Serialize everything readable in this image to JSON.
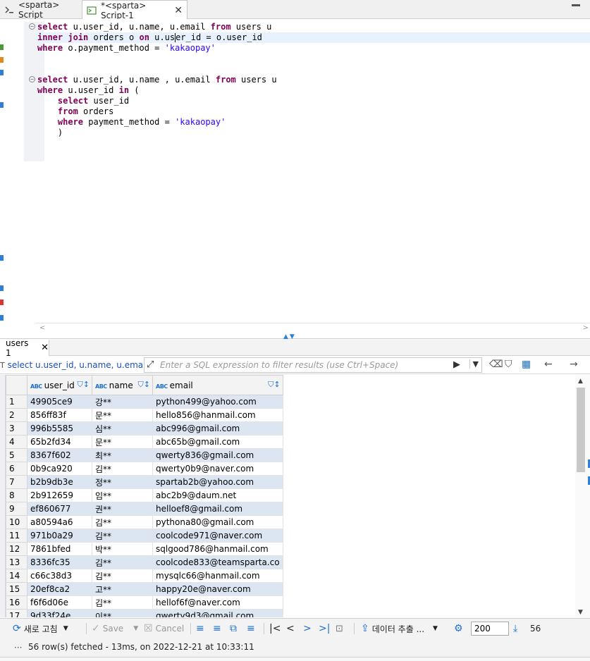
{
  "editor_tabs": [
    {
      "label": "<sparta> Script",
      "active": false
    },
    {
      "label": "*<sparta> Script-1",
      "active": true
    }
  ],
  "editor": {
    "lines": [
      [
        {
          "t": "select",
          "k": "kw"
        },
        {
          "t": " u.user_id, u.name, u.email "
        },
        {
          "t": "from",
          "k": "kw"
        },
        {
          "t": " users u"
        }
      ],
      [
        {
          "t": "inner join",
          "k": "kw"
        },
        {
          "t": " orders o "
        },
        {
          "t": "on",
          "k": "kw"
        },
        {
          "t": " u.us"
        },
        {
          "t": "",
          "k": "cursor"
        },
        {
          "t": "er_id = o.user_id"
        }
      ],
      [
        {
          "t": "where",
          "k": "kw"
        },
        {
          "t": " o.payment_method = "
        },
        {
          "t": "'kakaopay'",
          "k": "str"
        }
      ],
      [],
      [],
      [
        {
          "t": "select",
          "k": "kw"
        },
        {
          "t": " u.user_id, u.name , u.email "
        },
        {
          "t": "from",
          "k": "kw"
        },
        {
          "t": " users u"
        }
      ],
      [
        {
          "t": "where",
          "k": "kw"
        },
        {
          "t": " u.user_id "
        },
        {
          "t": "in",
          "k": "kw"
        },
        {
          "t": " ("
        }
      ],
      [
        {
          "t": "    "
        },
        {
          "t": "select",
          "k": "kw"
        },
        {
          "t": " user_id"
        }
      ],
      [
        {
          "t": "    "
        },
        {
          "t": "from",
          "k": "kw"
        },
        {
          "t": " orders"
        }
      ],
      [
        {
          "t": "    "
        },
        {
          "t": "where",
          "k": "kw"
        },
        {
          "t": " payment_method = "
        },
        {
          "t": "'kakaopay'",
          "k": "str"
        }
      ],
      [
        {
          "t": "    )"
        }
      ]
    ],
    "highlight_line": 1,
    "fold_lines": [
      0,
      5
    ]
  },
  "results": {
    "tab_label": "users 1",
    "query_preview": "select u.user_id, u.name, u.email from",
    "filter_placeholder": "Enter a SQL expression to filter results (use Ctrl+Space)",
    "columns": [
      {
        "type": "ABC",
        "name": "user_id"
      },
      {
        "type": "ABC",
        "name": "name"
      },
      {
        "type": "ABC",
        "name": "email"
      }
    ],
    "rows": [
      [
        "49905ce9",
        "강**",
        "python499@yahoo.com"
      ],
      [
        "856ff83f",
        "문**",
        "hello856@hanmail.com"
      ],
      [
        "996b5585",
        "심**",
        "abc996@gmail.com"
      ],
      [
        "65b2fd34",
        "문**",
        "abc65b@gmail.com"
      ],
      [
        "8367f602",
        "최**",
        "qwerty836@gmail.com"
      ],
      [
        "0b9ca920",
        "김**",
        "qwerty0b9@naver.com"
      ],
      [
        "b2b9db3e",
        "정**",
        "spartab2b@yahoo.com"
      ],
      [
        "2b912659",
        "임**",
        "abc2b9@daum.net"
      ],
      [
        "ef860677",
        "권**",
        "helloef8@gmail.com"
      ],
      [
        "a80594a6",
        "김**",
        "pythona80@gmail.com"
      ],
      [
        "971b0a29",
        "김**",
        "coolcode971@naver.com"
      ],
      [
        "7861bfed",
        "박**",
        "sqlgood786@hanmail.com"
      ],
      [
        "8336fc35",
        "김**",
        "coolcode833@teamsparta.co"
      ],
      [
        "c66c38d3",
        "김**",
        "mysqlc66@hanmail.com"
      ],
      [
        "20ef8ca2",
        "고**",
        "happy20e@naver.com"
      ],
      [
        "f6f6d06e",
        "김**",
        "hellof6f@naver.com"
      ],
      [
        "9d33f24e",
        "이**",
        "qwerty9d3@gmail.com"
      ]
    ]
  },
  "toolbar": {
    "refresh_label": "새로 고침",
    "save_label": "Save",
    "cancel_label": "Cancel",
    "export_label": "데이터 추출 ...",
    "fetch_size": "200",
    "row_count": "56"
  },
  "status": {
    "message": "56 row(s) fetched - 13ms, on 2022-12-21 at 10:33:11"
  },
  "colors": {
    "keyword": "#7f0055",
    "string": "#2a00ff",
    "alt_row": "#dce6f3",
    "accent": "#1a6fd1"
  }
}
